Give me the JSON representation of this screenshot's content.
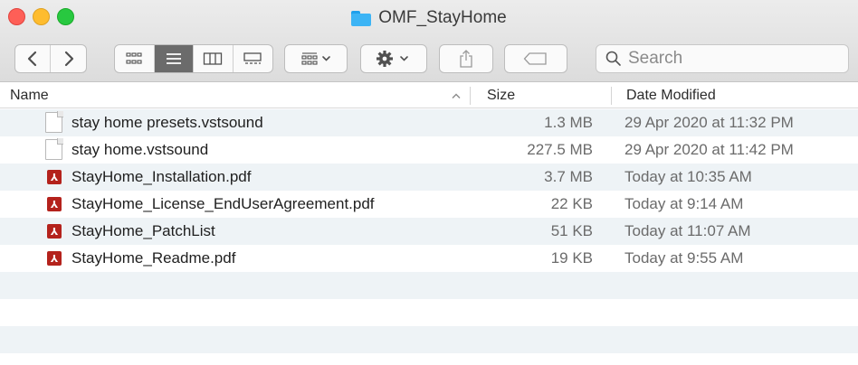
{
  "window": {
    "title": "OMF_StayHome",
    "folder_icon": "folder-icon"
  },
  "toolbar": {
    "back_icon": "chevron-left-icon",
    "forward_icon": "chevron-right-icon",
    "view_modes": [
      {
        "name": "icon-view",
        "icon": "grid-icon",
        "selected": false
      },
      {
        "name": "list-view",
        "icon": "list-icon",
        "selected": true
      },
      {
        "name": "column-view",
        "icon": "columns-icon",
        "selected": false
      },
      {
        "name": "gallery-view",
        "icon": "gallery-icon",
        "selected": false
      }
    ],
    "group_icon": "group-by-icon",
    "action_icon": "gear-icon",
    "share_icon": "share-icon",
    "tag_icon": "tag-icon",
    "search_placeholder": "Search"
  },
  "columns": {
    "name": "Name",
    "size": "Size",
    "date": "Date Modified",
    "sort_direction": "ascending"
  },
  "files": [
    {
      "name": "stay home presets.vstsound",
      "size": "1.3 MB",
      "date": "29 Apr 2020 at 11:32 PM",
      "type": "document"
    },
    {
      "name": "stay home.vstsound",
      "size": "227.5 MB",
      "date": "29 Apr 2020 at 11:42 PM",
      "type": "document"
    },
    {
      "name": "StayHome_Installation.pdf",
      "size": "3.7 MB",
      "date": "Today at 10:35 AM",
      "type": "pdf"
    },
    {
      "name": "StayHome_License_EndUserAgreement.pdf",
      "size": "22 KB",
      "date": "Today at 9:14 AM",
      "type": "pdf"
    },
    {
      "name": "StayHome_PatchList",
      "size": "51 KB",
      "date": "Today at 11:07 AM",
      "type": "pdf"
    },
    {
      "name": "StayHome_Readme.pdf",
      "size": "19 KB",
      "date": "Today at 9:55 AM",
      "type": "pdf"
    }
  ],
  "colors": {
    "close": "#fe5f57",
    "minimize": "#febc2e",
    "zoom": "#28c840",
    "row_stripe": "#eef3f6",
    "pdf_red": "#b4221c",
    "folder_blue": "#3cb4f5"
  }
}
